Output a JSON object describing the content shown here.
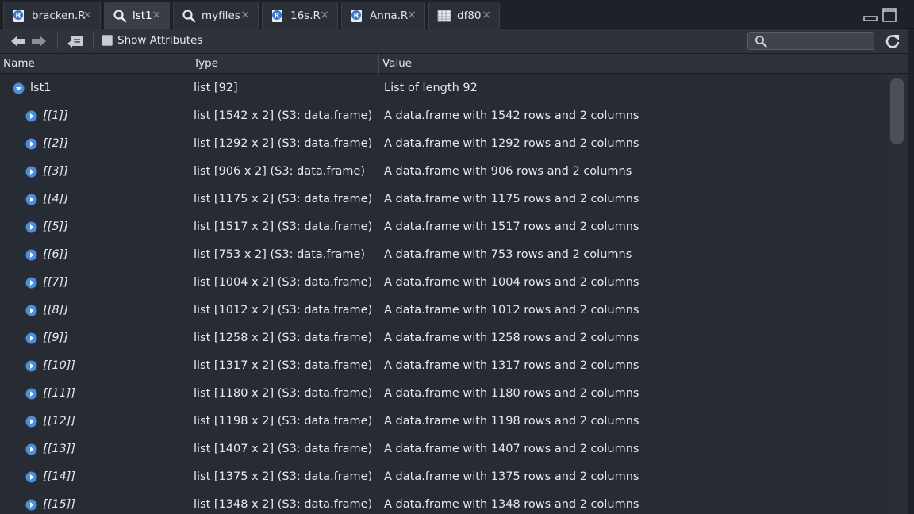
{
  "tabs": [
    {
      "label": "bracken.R",
      "icon": "r-file-icon"
    },
    {
      "label": "lst1",
      "icon": "search-icon"
    },
    {
      "label": "myfiles",
      "icon": "search-icon"
    },
    {
      "label": "16s.R",
      "icon": "r-file-icon"
    },
    {
      "label": "Anna.R",
      "icon": "r-file-icon"
    },
    {
      "label": "df80",
      "icon": "table-icon"
    }
  ],
  "tab_close_glyph": "×",
  "active_tab": "lst1",
  "toolbar": {
    "show_attributes_label": "Show Attributes",
    "show_attributes_checked": false,
    "search_value": "",
    "search_placeholder": ""
  },
  "columns": {
    "name": "Name",
    "type": "Type",
    "value": "Value"
  },
  "root": {
    "name": "lst1",
    "type": "list [92]",
    "value": "List of length 92",
    "expanded": true
  },
  "items": [
    {
      "name": "[[1]]",
      "type": "list [1542 x 2] (S3: data.frame)",
      "value": "A data.frame with 1542 rows and 2 columns"
    },
    {
      "name": "[[2]]",
      "type": "list [1292 x 2] (S3: data.frame)",
      "value": "A data.frame with 1292 rows and 2 columns"
    },
    {
      "name": "[[3]]",
      "type": "list [906 x 2] (S3: data.frame)",
      "value": "A data.frame with 906 rows and 2 columns"
    },
    {
      "name": "[[4]]",
      "type": "list [1175 x 2] (S3: data.frame)",
      "value": "A data.frame with 1175 rows and 2 columns"
    },
    {
      "name": "[[5]]",
      "type": "list [1517 x 2] (S3: data.frame)",
      "value": "A data.frame with 1517 rows and 2 columns"
    },
    {
      "name": "[[6]]",
      "type": "list [753 x 2] (S3: data.frame)",
      "value": "A data.frame with 753 rows and 2 columns"
    },
    {
      "name": "[[7]]",
      "type": "list [1004 x 2] (S3: data.frame)",
      "value": "A data.frame with 1004 rows and 2 columns"
    },
    {
      "name": "[[8]]",
      "type": "list [1012 x 2] (S3: data.frame)",
      "value": "A data.frame with 1012 rows and 2 columns"
    },
    {
      "name": "[[9]]",
      "type": "list [1258 x 2] (S3: data.frame)",
      "value": "A data.frame with 1258 rows and 2 columns"
    },
    {
      "name": "[[10]]",
      "type": "list [1317 x 2] (S3: data.frame)",
      "value": "A data.frame with 1317 rows and 2 columns"
    },
    {
      "name": "[[11]]",
      "type": "list [1180 x 2] (S3: data.frame)",
      "value": "A data.frame with 1180 rows and 2 columns"
    },
    {
      "name": "[[12]]",
      "type": "list [1198 x 2] (S3: data.frame)",
      "value": "A data.frame with 1198 rows and 2 columns"
    },
    {
      "name": "[[13]]",
      "type": "list [1407 x 2] (S3: data.frame)",
      "value": "A data.frame with 1407 rows and 2 columns"
    },
    {
      "name": "[[14]]",
      "type": "list [1375 x 2] (S3: data.frame)",
      "value": "A data.frame with 1375 rows and 2 columns"
    },
    {
      "name": "[[15]]",
      "type": "list [1348 x 2] (S3: data.frame)",
      "value": "A data.frame with 1348 rows and 2 columns"
    }
  ],
  "colors": {
    "background": "#272b33",
    "tab_active": "#383d46",
    "expander_blue": "#4a8fdd",
    "r_icon_blue": "#3a76c8"
  }
}
